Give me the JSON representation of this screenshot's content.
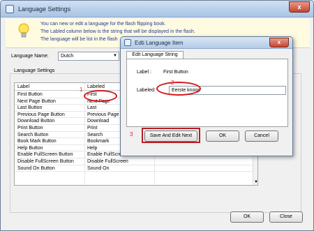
{
  "window": {
    "title": "Language Settings",
    "close_label": "x"
  },
  "info": {
    "lines": [
      "You can new or edit  a language for the flash flipping book.",
      "The Labled column below is the string that will be displayed in the flash.",
      "The language will be list in the flash"
    ]
  },
  "language": {
    "label": "Language Name:",
    "value": "Dutch"
  },
  "settings_group": {
    "title": "Language Settings"
  },
  "grid": {
    "headers": [
      "Label",
      "Labeled"
    ],
    "rows": [
      [
        "First Button",
        "First"
      ],
      [
        "Next Page Button",
        "Next Page"
      ],
      [
        "Last Button",
        "Last"
      ],
      [
        "Previous Page Button",
        "Previous Page"
      ],
      [
        "Download Button",
        "Download"
      ],
      [
        "Print Button",
        "Print"
      ],
      [
        "Search Button",
        "Search"
      ],
      [
        "Book Mark Button",
        "Bookmark"
      ],
      [
        "Help Button",
        "Help"
      ],
      [
        "Enable FullScreen Button",
        "Enable FullScreen"
      ],
      [
        "Disable FullScreen Button",
        "Disable FullScreen"
      ],
      [
        "Sound On Button",
        "Sound On"
      ]
    ]
  },
  "buttons": {
    "ok": "OK",
    "close": "Close"
  },
  "dialog": {
    "title": "Edti Language Item",
    "close_label": "x",
    "tab": "Edit Language String",
    "label_caption": "Label :",
    "label_value": "First Button",
    "labeled_caption": "Labeled:",
    "labeled_value": "Eerste knoop",
    "buttons": {
      "save_next": "Save And Edit Next",
      "ok": "OK",
      "cancel": "Cancel"
    }
  },
  "annotations": {
    "n1": "1",
    "n2": "2",
    "n3": "3",
    "color": "#d4191c"
  }
}
